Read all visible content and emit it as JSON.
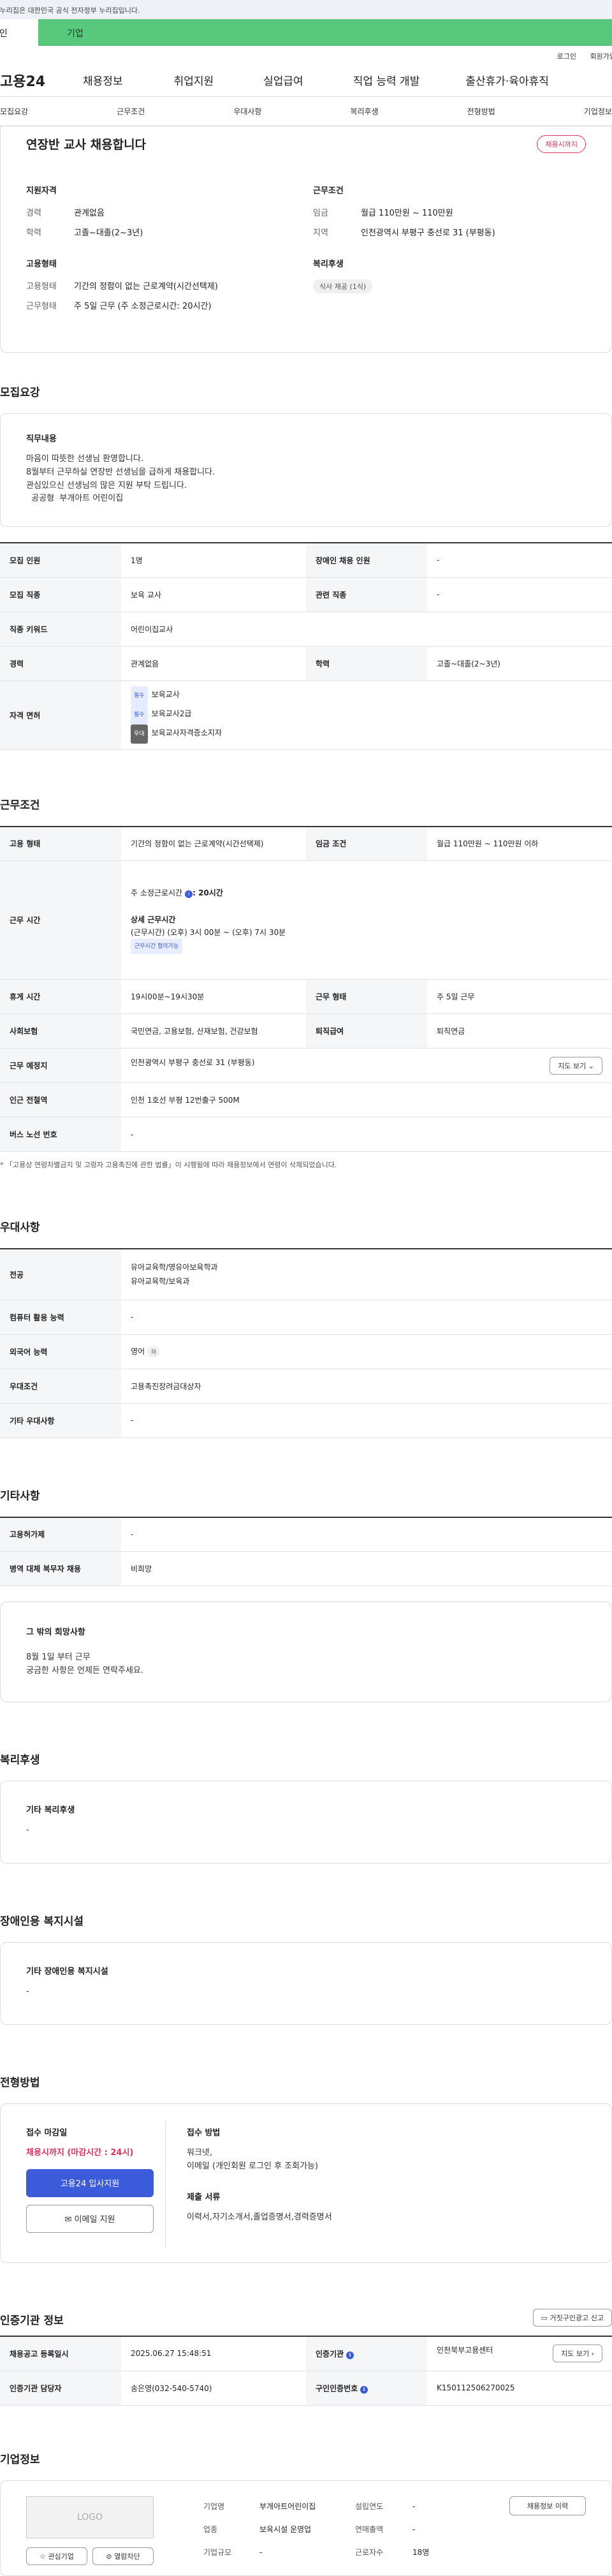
{
  "gov_banner": "이 누리집은 대한민국 공식 전자정부 누리집입니다.",
  "tabs": {
    "person": "개인",
    "biz": "기업"
  },
  "util": {
    "login": "로그인",
    "join": "회원가입"
  },
  "gnb": {
    "logo": "고용24",
    "items": [
      "채용정보",
      "취업지원",
      "실업급여",
      "직업 능력 개발",
      "출산휴가·육아휴직"
    ]
  },
  "subnav": [
    "모집요강",
    "근무조건",
    "우대사항",
    "복리후생",
    "전형방법",
    "기업정보"
  ],
  "summary": {
    "title": "연장반 교사 채용합니다",
    "badge": "채용시까지",
    "qual_h": "지원자격",
    "qual": [
      {
        "k": "경력",
        "v": "관계없음"
      },
      {
        "k": "학력",
        "v": "고졸~대졸(2~3년)"
      }
    ],
    "cond_h": "근무조건",
    "cond": [
      {
        "k": "임금",
        "v": "월급 110만원 ~ 110만원"
      },
      {
        "k": "지역",
        "v": "인천광역시 부평구 충선로 31 (부평동)"
      }
    ],
    "emp_h": "고용형태",
    "emp": [
      {
        "k": "고용형태",
        "v": "기간의 정함이 없는 근로계약(시간선택제)"
      },
      {
        "k": "근무형태",
        "v": "주 5일 근무 (주 소정근로시간: 20시간)"
      }
    ],
    "welfare_h": "복리후생",
    "welfare_chip": "식사 제공 (1식)"
  },
  "recruit": {
    "title": "모집요강",
    "duty_h": "직무내용",
    "duty_lines": [
      "마음이 따뜻한 선생님 환영합니다.",
      "8월부터 근무하실 연장반 선생님을 급하게 채용합니다.",
      "관심있으신 선생님의 많은 지원 부탁 드립니다.",
      "  공공형  부개아트 어린이집"
    ],
    "rows": {
      "count_k": "모집 인원",
      "count_v": "1명",
      "dis_k": "장애인 채용 인원",
      "dis_v": "-",
      "job_k": "모집 직종",
      "job_v": "보육 교사",
      "rel_k": "관련 직종",
      "rel_v": "-",
      "kw_k": "직종 키워드",
      "kw_v": "어린이집교사",
      "career_k": "경력",
      "career_v": "관계없음",
      "edu_k": "학력",
      "edu_v": "고졸~대졸(2~3년)",
      "lic_k": "자격 면허",
      "licenses": [
        {
          "tag": "필수",
          "name": "보육교사"
        },
        {
          "tag": "필수",
          "name": "보육교사2급"
        },
        {
          "tag": "우대",
          "name": "보육교사자격증소지자"
        }
      ]
    }
  },
  "work": {
    "title": "근무조건",
    "type_k": "고용 형태",
    "type_v": "기간의 정함이 없는 근로계약(시간선택제)",
    "wage_k": "임금 조건",
    "wage_v": "월급 110만원 ~ 110만원 이하",
    "time_k": "근무 시간",
    "weekly_prefix": "주 소정근로시간",
    "weekly_val": ": 20시간",
    "detail_h": "상세 근무시간",
    "detail_v": "(근무시간) (오후) 3시 00분 ~ (오후) 7시 30분",
    "nego": "근무시간 협의가능",
    "rest_k": "휴게 시간",
    "rest_v": "19시00분~19시30분",
    "form_k": "근무 형태",
    "form_v": "주 5일 근무",
    "ins_k": "사회보험",
    "ins_v": "국민연금, 고용보험, 산재보험, 건강보험",
    "ret_k": "퇴직급여",
    "ret_v": "퇴직연금",
    "place_k": "근무 예정지",
    "place_v": "인천광역시 부평구 충선로 31 (부평동)",
    "map_btn": "지도 보기",
    "subway_k": "인근 전철역",
    "subway_v": "인천 1호선 부평 12번출구 500M",
    "bus_k": "버스 노선 번호",
    "bus_v": "-",
    "note": "「고용상 연령차별금지 및 고령자 고용촉진에 관한 법률」이 시행됨에 따라 채용정보에서 연령이 삭제되었습니다."
  },
  "pref": {
    "title": "우대사항",
    "major_k": "전공",
    "major_v1": "유아교육학/영유아보육학과",
    "major_v2": "유아교육학/보육과",
    "pc_k": "컴퓨터 활용 능력",
    "pc_v": "-",
    "lang_k": "외국어 능력",
    "lang_v": "영어",
    "lang_tag": "하",
    "cond_k": "우대조건",
    "cond_v": "고용촉진장려금대상자",
    "etc_k": "기타 우대사항",
    "etc_v": "-"
  },
  "other": {
    "title": "기타사항",
    "sub_k": "고용허가제",
    "sub_v": "-",
    "mil_k": "병역 대체 복무자 채용",
    "mil_v": "비희망",
    "wish_h": "그 밖의 희망사항",
    "wish_lines": [
      "8월 1일 부터 근무",
      "궁금한 사항은 언제든 연락주세요."
    ]
  },
  "welfare": {
    "title": "복리후생",
    "h": "기타 복리후생",
    "v": "-"
  },
  "disfac": {
    "title": "장애인용 복지시설",
    "h": "기타 장애인용 복지시설",
    "v": "-"
  },
  "apply": {
    "title": "전형방법",
    "deadline_h": "접수 마감일",
    "deadline_v": "채용시까지 (마감시간 : 24시)",
    "btn1": "고용24 입사지원",
    "btn2": "이메일 지원",
    "method_h": "접수 방법",
    "method_v1": "워크넷,",
    "method_v2": "이메일 (개인회원 로그인 후 조회가능)",
    "docs_h": "제출 서류",
    "docs_v": "이력서,자기소개서,졸업증명서,경력증명서"
  },
  "agency": {
    "title": "인증기관 정보",
    "report_btn": "거짓구인광고 신고",
    "reg_k": "채용공고 등록일시",
    "reg_v": "2025.06.27 15:48:51",
    "org_k": "인증기관",
    "org_v": "인천북부고용센터",
    "map_btn": "지도 보기",
    "mgr_k": "인증기관 담당자",
    "mgr_v": "송은영(032-540-5740)",
    "no_k": "구인인증번호",
    "no_v": "K150112506270025"
  },
  "company": {
    "title": "기업정보",
    "logo": "LOGO",
    "fav_btn": "관심기업",
    "block_btn": "열람차단",
    "name_k": "기업명",
    "name_v": "부개아트어린이집",
    "year_k": "설립연도",
    "year_v": "-",
    "ind_k": "업종",
    "ind_v": "보육시설 운영업",
    "sales_k": "연매출액",
    "sales_v": "-",
    "size_k": "기업규모",
    "size_v": "-",
    "emp_k": "근로자수",
    "emp_v": "18명",
    "history_btn": "채용정보 이력"
  },
  "colors": {
    "biz_tab": "#58c97c",
    "accent": "#3b5bdb",
    "deadline": "#e0335a"
  }
}
